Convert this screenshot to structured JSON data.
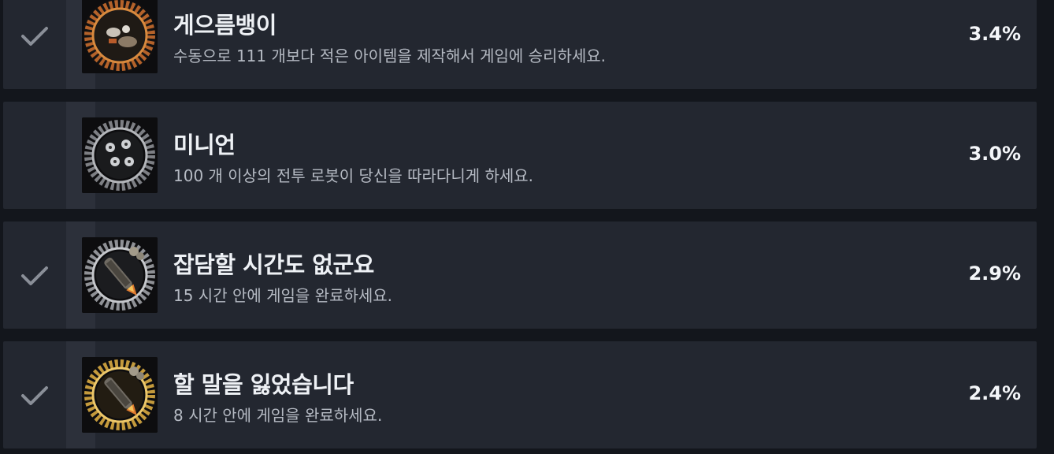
{
  "achievements": [
    {
      "title": "게으름뱅이",
      "description": "수동으로 111 개보다 적은 아이템을 제작해서 게임에 승리하세요.",
      "percent": "3.4%",
      "unlocked": true,
      "icon": "lazy-bastard-icon",
      "ring_color": "#c06a2a"
    },
    {
      "title": "미니언",
      "description": "100 개 이상의 전투 로봇이 당신을 따라다니게 하세요.",
      "percent": "3.0%",
      "unlocked": false,
      "icon": "minions-icon",
      "ring_color": "#8d8f93"
    },
    {
      "title": "잡담할 시간도 없군요",
      "description": "15 시간 안에 게임을 완료하세요.",
      "percent": "2.9%",
      "unlocked": true,
      "icon": "rocket-silver-icon",
      "ring_color": "#9a9ca0"
    },
    {
      "title": "할 말을 잃었습니다",
      "description": "8 시간 안에 게임을 완료하세요.",
      "percent": "2.4%",
      "unlocked": true,
      "icon": "rocket-gold-icon",
      "ring_color": "#d2a94a"
    }
  ],
  "colors": {
    "row_background": "#232730",
    "page_background": "#13161c",
    "check": "#8a8f98",
    "title": "#eef1f5",
    "description": "#b5bac3"
  }
}
